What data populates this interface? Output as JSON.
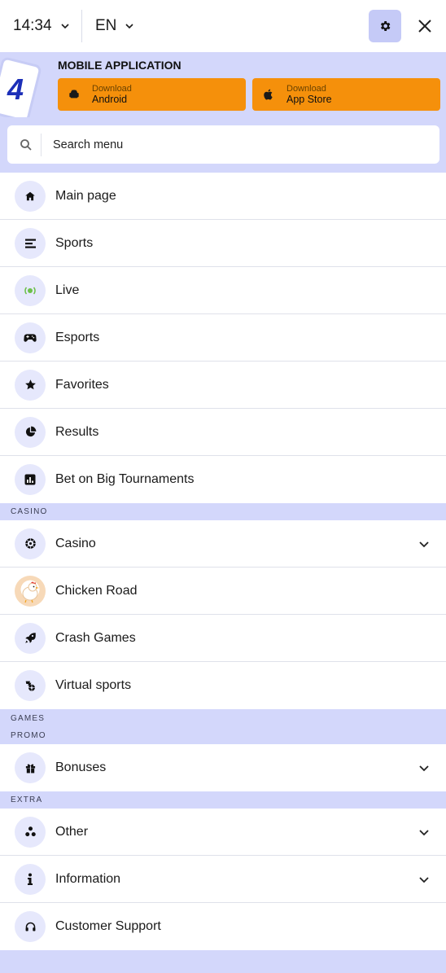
{
  "header": {
    "time": "14:34",
    "language": "EN",
    "settings_icon": "gear-icon",
    "close_icon": "close-icon"
  },
  "app_banner": {
    "title": "MOBILE APPLICATION",
    "logo_text": "4",
    "android": {
      "small": "Download",
      "big": "Android",
      "icon": "android-icon"
    },
    "ios": {
      "small": "Download",
      "big": "App Store",
      "icon": "apple-icon"
    }
  },
  "search": {
    "placeholder": "Search menu",
    "icon": "search-icon"
  },
  "main_menu": [
    {
      "label": "Main page",
      "icon": "home-icon"
    },
    {
      "label": "Sports",
      "icon": "sports-list-icon"
    },
    {
      "label": "Live",
      "icon": "live-broadcast-icon"
    },
    {
      "label": "Esports",
      "icon": "gamepad-icon"
    },
    {
      "label": "Favorites",
      "icon": "star-icon"
    },
    {
      "label": "Results",
      "icon": "pie-chart-icon"
    },
    {
      "label": "Bet on Big Tournaments",
      "icon": "bar-chart-icon"
    }
  ],
  "sections": {
    "casino": "CASINO",
    "games": "GAMES",
    "promo": "PROMO",
    "extra": "EXTRA"
  },
  "casino_menu": [
    {
      "label": "Casino",
      "icon": "roulette-icon",
      "expandable": true
    },
    {
      "label": "Chicken Road",
      "icon": "chicken-icon",
      "expandable": false
    },
    {
      "label": "Crash Games",
      "icon": "rocket-icon",
      "expandable": false
    },
    {
      "label": "Virtual sports",
      "icon": "virtual-sports-icon",
      "expandable": false
    }
  ],
  "promo_menu": [
    {
      "label": "Bonuses",
      "icon": "gift-icon",
      "expandable": true
    }
  ],
  "extra_menu": [
    {
      "label": "Other",
      "icon": "three-dots-icon",
      "expandable": true
    },
    {
      "label": "Information",
      "icon": "info-icon",
      "expandable": true
    },
    {
      "label": "Customer Support",
      "icon": "headset-icon",
      "expandable": false
    }
  ],
  "colors": {
    "band": "#d3d7fb",
    "icon_circle": "#e6e8fc",
    "download_button": "#f5900b",
    "settings_button": "#c5caf7",
    "live_dot": "#6cc04a"
  }
}
